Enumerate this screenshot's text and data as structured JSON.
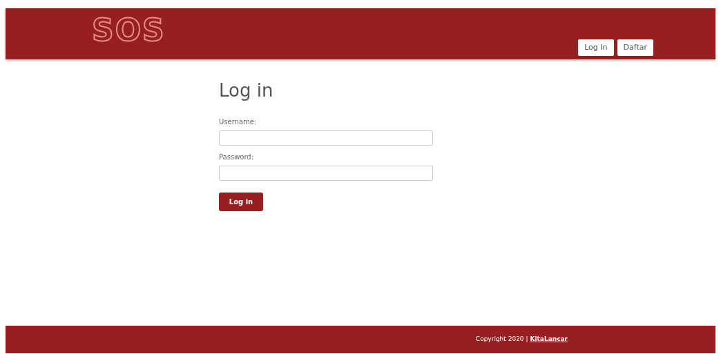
{
  "header": {
    "logo": "SOS",
    "nav": [
      {
        "label": "Log In"
      },
      {
        "label": "Daftar"
      }
    ]
  },
  "form": {
    "title": "Log in",
    "fields": [
      {
        "label": "Username:"
      },
      {
        "label": "Password:"
      }
    ],
    "submit": "Log in"
  },
  "footer": {
    "copyright": "Copyright 2020 |",
    "link": "KitaLancar"
  }
}
